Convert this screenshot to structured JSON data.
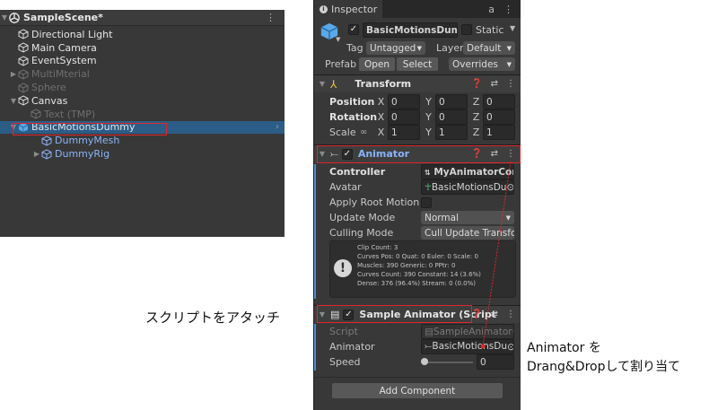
{
  "hierarchy": {
    "scene": "SampleScene*",
    "menu_glyph": "⋮",
    "items": [
      {
        "label": "Directional Light"
      },
      {
        "label": "Main Camera"
      },
      {
        "label": "EventSystem"
      },
      {
        "label": "MultiMterial"
      },
      {
        "label": "Sphere"
      },
      {
        "label": "Canvas"
      },
      {
        "label": "Text (TMP)"
      },
      {
        "label": "BasicMotionsDummy"
      },
      {
        "label": "DummyMesh"
      },
      {
        "label": "DummyRig"
      }
    ]
  },
  "inspector": {
    "tab": "Inspector",
    "object_name": "BasicMotionsDummy",
    "static_label": "Static",
    "tag_label": "Tag",
    "tag_value": "Untagged",
    "layer_label": "Layer",
    "layer_value": "Default",
    "prefab_label": "Prefab",
    "open_label": "Open",
    "select_label": "Select",
    "overrides_label": "Overrides",
    "transform": {
      "title": "Transform",
      "position_label": "Position",
      "rotation_label": "Rotation",
      "scale_label": "Scale",
      "position": [
        "0",
        "0",
        "0"
      ],
      "rotation": [
        "0",
        "0",
        "0"
      ],
      "scale": [
        "1",
        "1",
        "1"
      ]
    },
    "animator": {
      "title": "Animator",
      "controller_label": "Controller",
      "controller_value": "MyAnimatorCor",
      "avatar_label": "Avatar",
      "avatar_value": "BasicMotionsDu",
      "apply_root_label": "Apply Root Motion",
      "update_mode_label": "Update Mode",
      "update_mode_value": "Normal",
      "culling_label": "Culling Mode",
      "culling_value": "Cull Update Transfo",
      "info_lines": [
        "Clip Count: 3",
        "Curves Pos: 0 Quat: 0 Euler: 0 Scale: 0",
        "Muscles: 390 Generic: 0 PPtr: 0",
        "Curves Count: 390 Constant: 14 (3.6%)",
        "Dense: 376 (96.4%) Stream: 0 (0.0%)"
      ]
    },
    "sample_animator": {
      "title": "Sample Animator (Script",
      "script_label": "Script",
      "script_value": "SampleAnimator",
      "animator_label": "Animator",
      "animator_value": "BasicMotionsDu",
      "speed_label": "Speed",
      "speed_value": "0",
      "speed_fraction": 0.0
    },
    "add_component": "Add Component"
  },
  "annotations": {
    "attach_script": "スクリプトをアタッチ",
    "drag_line1": "Animator を",
    "drag_line2": "Drang&Dropして割り当て"
  },
  "colors": {
    "highlight_red": "#e0262b",
    "selection_blue": "#2c5d87",
    "prefab_blue": "#8ab4f8",
    "panel_bg": "#383838"
  }
}
